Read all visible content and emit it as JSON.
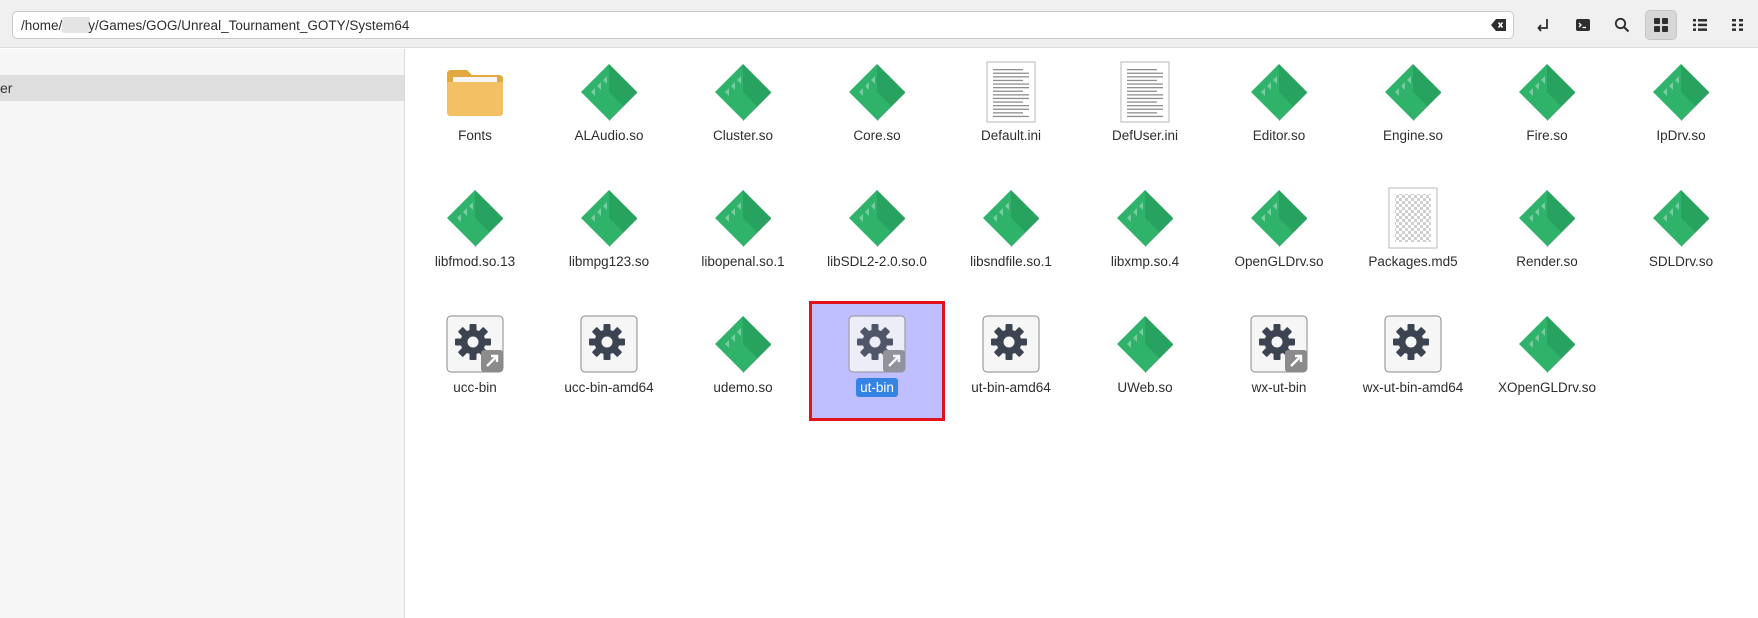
{
  "path": {
    "prefix": "/home/",
    "redacted": "",
    "suffix": "y/Games/GOG/Unreal_Tournament_GOTY/System64"
  },
  "toolbar": {
    "buttons": [
      "open-terminal-arrow-icon",
      "terminal-icon",
      "search-icon",
      "grid-view-icon",
      "list-view-icon",
      "compact-view-icon"
    ],
    "active": "grid-view-icon"
  },
  "sidebar": {
    "items": [
      {
        "label": "er",
        "selected": true
      }
    ]
  },
  "files": [
    {
      "name": "Fonts",
      "type": "folder"
    },
    {
      "name": "ALAudio.so",
      "type": "library"
    },
    {
      "name": "Cluster.so",
      "type": "library"
    },
    {
      "name": "Core.so",
      "type": "library"
    },
    {
      "name": "Default.ini",
      "type": "text"
    },
    {
      "name": "DefUser.ini",
      "type": "text"
    },
    {
      "name": "Editor.so",
      "type": "library"
    },
    {
      "name": "Engine.so",
      "type": "library"
    },
    {
      "name": "Fire.so",
      "type": "library"
    },
    {
      "name": "IpDrv.so",
      "type": "library"
    },
    {
      "name": "libfmod.so.13",
      "type": "library"
    },
    {
      "name": "libmpg123.so",
      "type": "library"
    },
    {
      "name": "libopenal.so.1",
      "type": "library"
    },
    {
      "name": "libSDL2-2.0.so.0",
      "type": "library"
    },
    {
      "name": "libsndfile.so.1",
      "type": "library"
    },
    {
      "name": "libxmp.so.4",
      "type": "library"
    },
    {
      "name": "OpenGLDrv.so",
      "type": "library"
    },
    {
      "name": "Packages.md5",
      "type": "unknown"
    },
    {
      "name": "Render.so",
      "type": "library"
    },
    {
      "name": "SDLDrv.so",
      "type": "library"
    },
    {
      "name": "ucc-bin",
      "type": "executable-link"
    },
    {
      "name": "ucc-bin-amd64",
      "type": "executable"
    },
    {
      "name": "udemo.so",
      "type": "library"
    },
    {
      "name": "ut-bin",
      "type": "executable-link",
      "selected": true
    },
    {
      "name": "ut-bin-amd64",
      "type": "executable"
    },
    {
      "name": "UWeb.so",
      "type": "library"
    },
    {
      "name": "wx-ut-bin",
      "type": "executable-link"
    },
    {
      "name": "wx-ut-bin-amd64",
      "type": "executable"
    },
    {
      "name": "XOpenGLDrv.so",
      "type": "library"
    }
  ],
  "colors": {
    "library": "#2fb36b",
    "library_dark": "#1f8f52",
    "folder": "#f3c063",
    "selection": "#bfbfff",
    "label_selected": "#3584e4",
    "highlight_box": "#e0121a"
  }
}
